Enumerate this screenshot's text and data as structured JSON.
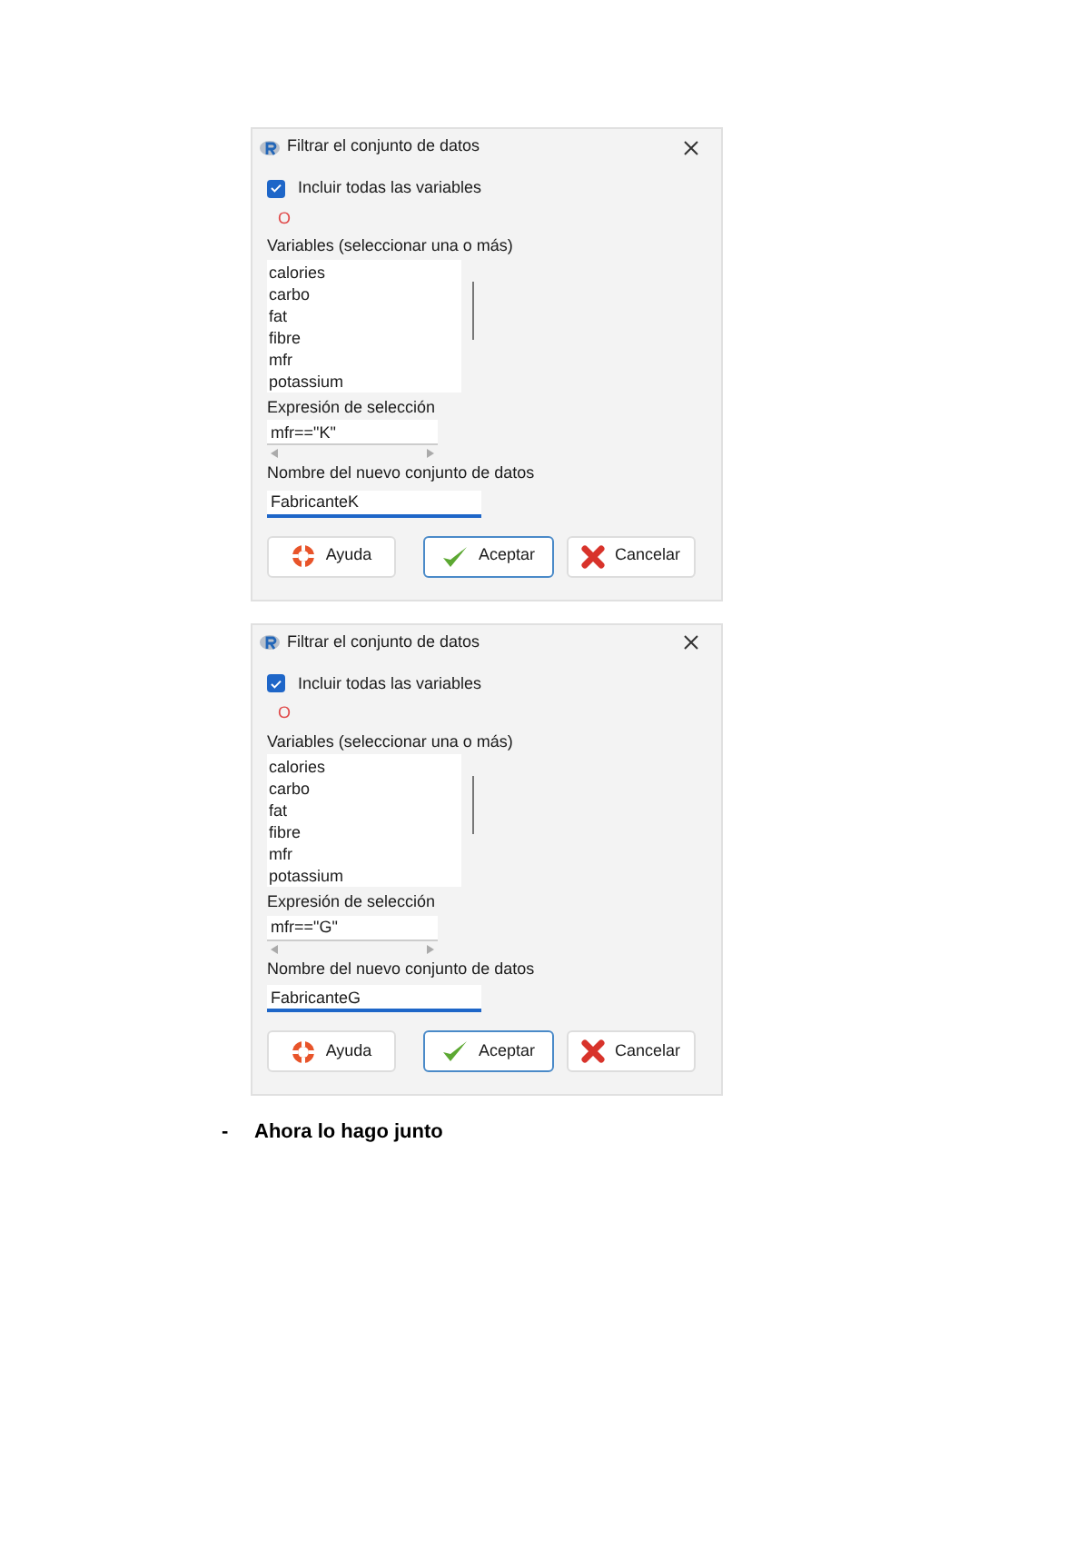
{
  "dialogs": [
    {
      "title": "Filtrar el conjunto de datos",
      "include_all": {
        "label": "Incluir todas las variables",
        "checked": true
      },
      "marker": "O",
      "variables_label": "Variables (seleccionar una o más)",
      "variables": [
        "calories",
        "carbo",
        "fat",
        "fibre",
        "mfr",
        "potassium"
      ],
      "expression_label": "Expresión de selección",
      "expression": "mfr==\"K\"",
      "name_label": "Nombre del nuevo conjunto de datos",
      "name": "FabricanteK",
      "name_focused": true,
      "buttons": [
        {
          "label": "Ayuda",
          "kind": "help",
          "default": false
        },
        {
          "label": "Aceptar",
          "kind": "accept",
          "default": true
        },
        {
          "label": "Cancelar",
          "kind": "cancel",
          "default": false
        }
      ]
    },
    {
      "title": "Filtrar el conjunto de datos",
      "include_all": {
        "label": "Incluir todas las variables",
        "checked": true
      },
      "marker": "O",
      "variables_label": "Variables (seleccionar una o más)",
      "variables": [
        "calories",
        "carbo",
        "fat",
        "fibre",
        "mfr",
        "potassium"
      ],
      "expression_label": "Expresión de selección",
      "expression": "mfr==\"G\"",
      "name_label": "Nombre del nuevo conjunto de datos",
      "name": "FabricanteG",
      "name_focused": true,
      "buttons": [
        {
          "label": "Ayuda",
          "kind": "help",
          "default": false
        },
        {
          "label": "Aceptar",
          "kind": "accept",
          "default": true
        },
        {
          "label": "Cancelar",
          "kind": "cancel",
          "default": false
        }
      ]
    }
  ],
  "bullet": {
    "marker": "-",
    "text": "Ahora lo hago junto"
  }
}
